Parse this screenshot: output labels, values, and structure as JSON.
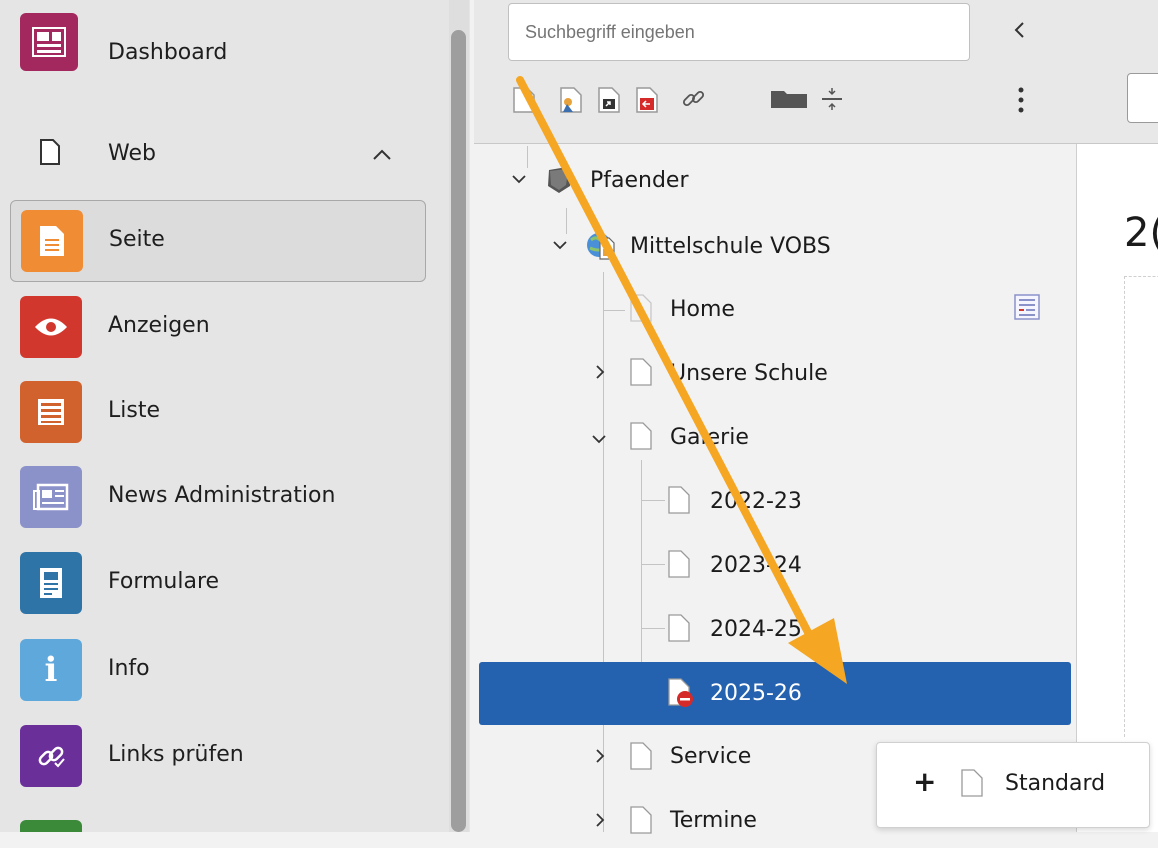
{
  "module_menu": {
    "items": [
      {
        "label": "Dashboard",
        "icon": "dashboard-icon",
        "color": "#a3285e"
      },
      {
        "label": "Web",
        "icon": "page-outline-icon",
        "color": ""
      },
      {
        "label": "Seite",
        "icon": "page-module-icon",
        "color": "#f08c34"
      },
      {
        "label": "Anzeigen",
        "icon": "eye-icon",
        "color": "#d1372d"
      },
      {
        "label": "Liste",
        "icon": "list-icon",
        "color": "#d2622d"
      },
      {
        "label": "News Administration",
        "icon": "news-icon",
        "color": "#8b91c9"
      },
      {
        "label": "Formulare",
        "icon": "form-icon",
        "color": "#2f74a6"
      },
      {
        "label": "Info",
        "icon": "info-icon",
        "color": "#5fa8dc"
      },
      {
        "label": "Links prüfen",
        "icon": "link-icon",
        "color": "#6b2f9a"
      }
    ]
  },
  "tree": {
    "search_placeholder": "Suchbegriff eingeben",
    "nodes": [
      {
        "label": "Pfaender"
      },
      {
        "label": "Mittelschule VOBS"
      },
      {
        "label": "Home"
      },
      {
        "label": "Unsere Schule"
      },
      {
        "label": "Galerie"
      },
      {
        "label": "2022-23"
      },
      {
        "label": "2023-24"
      },
      {
        "label": "2024-25"
      },
      {
        "label": "2025-26"
      },
      {
        "label": "Service"
      },
      {
        "label": "Termine"
      }
    ]
  },
  "dropdown": {
    "plus": "+",
    "label": "Standard"
  },
  "content": {
    "heading_partial": "2("
  }
}
